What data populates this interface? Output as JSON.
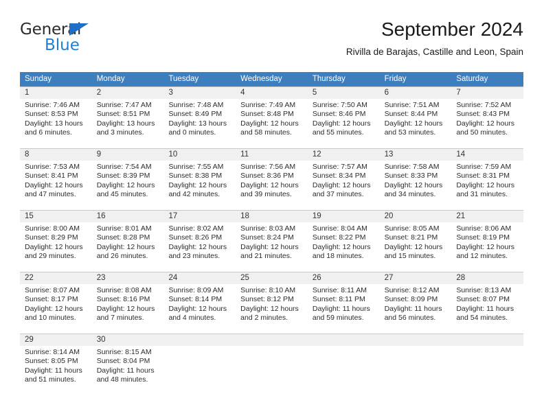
{
  "logo": {
    "word_top": "General",
    "word_bottom": "Blue",
    "triangle": "blue-triangle-icon",
    "color_dark": "#2b2b2b",
    "color_blue": "#1f7fd4"
  },
  "header": {
    "title": "September 2024",
    "subtitle": "Rivilla de Barajas, Castille and Leon, Spain"
  },
  "colors": {
    "header_blue": "#3d7ebe",
    "day_band_gray": "#f0f0f0",
    "grid_line": "#c8c8c8"
  },
  "weekdays": [
    "Sunday",
    "Monday",
    "Tuesday",
    "Wednesday",
    "Thursday",
    "Friday",
    "Saturday"
  ],
  "weeks": [
    {
      "numbers": [
        "1",
        "2",
        "3",
        "4",
        "5",
        "6",
        "7"
      ],
      "days": [
        {
          "sunrise": "Sunrise: 7:46 AM",
          "sunset": "Sunset: 8:53 PM",
          "daylight_1": "Daylight: 13 hours",
          "daylight_2": "and 6 minutes."
        },
        {
          "sunrise": "Sunrise: 7:47 AM",
          "sunset": "Sunset: 8:51 PM",
          "daylight_1": "Daylight: 13 hours",
          "daylight_2": "and 3 minutes."
        },
        {
          "sunrise": "Sunrise: 7:48 AM",
          "sunset": "Sunset: 8:49 PM",
          "daylight_1": "Daylight: 13 hours",
          "daylight_2": "and 0 minutes."
        },
        {
          "sunrise": "Sunrise: 7:49 AM",
          "sunset": "Sunset: 8:48 PM",
          "daylight_1": "Daylight: 12 hours",
          "daylight_2": "and 58 minutes."
        },
        {
          "sunrise": "Sunrise: 7:50 AM",
          "sunset": "Sunset: 8:46 PM",
          "daylight_1": "Daylight: 12 hours",
          "daylight_2": "and 55 minutes."
        },
        {
          "sunrise": "Sunrise: 7:51 AM",
          "sunset": "Sunset: 8:44 PM",
          "daylight_1": "Daylight: 12 hours",
          "daylight_2": "and 53 minutes."
        },
        {
          "sunrise": "Sunrise: 7:52 AM",
          "sunset": "Sunset: 8:43 PM",
          "daylight_1": "Daylight: 12 hours",
          "daylight_2": "and 50 minutes."
        }
      ]
    },
    {
      "numbers": [
        "8",
        "9",
        "10",
        "11",
        "12",
        "13",
        "14"
      ],
      "days": [
        {
          "sunrise": "Sunrise: 7:53 AM",
          "sunset": "Sunset: 8:41 PM",
          "daylight_1": "Daylight: 12 hours",
          "daylight_2": "and 47 minutes."
        },
        {
          "sunrise": "Sunrise: 7:54 AM",
          "sunset": "Sunset: 8:39 PM",
          "daylight_1": "Daylight: 12 hours",
          "daylight_2": "and 45 minutes."
        },
        {
          "sunrise": "Sunrise: 7:55 AM",
          "sunset": "Sunset: 8:38 PM",
          "daylight_1": "Daylight: 12 hours",
          "daylight_2": "and 42 minutes."
        },
        {
          "sunrise": "Sunrise: 7:56 AM",
          "sunset": "Sunset: 8:36 PM",
          "daylight_1": "Daylight: 12 hours",
          "daylight_2": "and 39 minutes."
        },
        {
          "sunrise": "Sunrise: 7:57 AM",
          "sunset": "Sunset: 8:34 PM",
          "daylight_1": "Daylight: 12 hours",
          "daylight_2": "and 37 minutes."
        },
        {
          "sunrise": "Sunrise: 7:58 AM",
          "sunset": "Sunset: 8:33 PM",
          "daylight_1": "Daylight: 12 hours",
          "daylight_2": "and 34 minutes."
        },
        {
          "sunrise": "Sunrise: 7:59 AM",
          "sunset": "Sunset: 8:31 PM",
          "daylight_1": "Daylight: 12 hours",
          "daylight_2": "and 31 minutes."
        }
      ]
    },
    {
      "numbers": [
        "15",
        "16",
        "17",
        "18",
        "19",
        "20",
        "21"
      ],
      "days": [
        {
          "sunrise": "Sunrise: 8:00 AM",
          "sunset": "Sunset: 8:29 PM",
          "daylight_1": "Daylight: 12 hours",
          "daylight_2": "and 29 minutes."
        },
        {
          "sunrise": "Sunrise: 8:01 AM",
          "sunset": "Sunset: 8:28 PM",
          "daylight_1": "Daylight: 12 hours",
          "daylight_2": "and 26 minutes."
        },
        {
          "sunrise": "Sunrise: 8:02 AM",
          "sunset": "Sunset: 8:26 PM",
          "daylight_1": "Daylight: 12 hours",
          "daylight_2": "and 23 minutes."
        },
        {
          "sunrise": "Sunrise: 8:03 AM",
          "sunset": "Sunset: 8:24 PM",
          "daylight_1": "Daylight: 12 hours",
          "daylight_2": "and 21 minutes."
        },
        {
          "sunrise": "Sunrise: 8:04 AM",
          "sunset": "Sunset: 8:22 PM",
          "daylight_1": "Daylight: 12 hours",
          "daylight_2": "and 18 minutes."
        },
        {
          "sunrise": "Sunrise: 8:05 AM",
          "sunset": "Sunset: 8:21 PM",
          "daylight_1": "Daylight: 12 hours",
          "daylight_2": "and 15 minutes."
        },
        {
          "sunrise": "Sunrise: 8:06 AM",
          "sunset": "Sunset: 8:19 PM",
          "daylight_1": "Daylight: 12 hours",
          "daylight_2": "and 12 minutes."
        }
      ]
    },
    {
      "numbers": [
        "22",
        "23",
        "24",
        "25",
        "26",
        "27",
        "28"
      ],
      "days": [
        {
          "sunrise": "Sunrise: 8:07 AM",
          "sunset": "Sunset: 8:17 PM",
          "daylight_1": "Daylight: 12 hours",
          "daylight_2": "and 10 minutes."
        },
        {
          "sunrise": "Sunrise: 8:08 AM",
          "sunset": "Sunset: 8:16 PM",
          "daylight_1": "Daylight: 12 hours",
          "daylight_2": "and 7 minutes."
        },
        {
          "sunrise": "Sunrise: 8:09 AM",
          "sunset": "Sunset: 8:14 PM",
          "daylight_1": "Daylight: 12 hours",
          "daylight_2": "and 4 minutes."
        },
        {
          "sunrise": "Sunrise: 8:10 AM",
          "sunset": "Sunset: 8:12 PM",
          "daylight_1": "Daylight: 12 hours",
          "daylight_2": "and 2 minutes."
        },
        {
          "sunrise": "Sunrise: 8:11 AM",
          "sunset": "Sunset: 8:11 PM",
          "daylight_1": "Daylight: 11 hours",
          "daylight_2": "and 59 minutes."
        },
        {
          "sunrise": "Sunrise: 8:12 AM",
          "sunset": "Sunset: 8:09 PM",
          "daylight_1": "Daylight: 11 hours",
          "daylight_2": "and 56 minutes."
        },
        {
          "sunrise": "Sunrise: 8:13 AM",
          "sunset": "Sunset: 8:07 PM",
          "daylight_1": "Daylight: 11 hours",
          "daylight_2": "and 54 minutes."
        }
      ]
    },
    {
      "numbers": [
        "29",
        "30",
        "",
        "",
        "",
        "",
        ""
      ],
      "days": [
        {
          "sunrise": "Sunrise: 8:14 AM",
          "sunset": "Sunset: 8:05 PM",
          "daylight_1": "Daylight: 11 hours",
          "daylight_2": "and 51 minutes."
        },
        {
          "sunrise": "Sunrise: 8:15 AM",
          "sunset": "Sunset: 8:04 PM",
          "daylight_1": "Daylight: 11 hours",
          "daylight_2": "and 48 minutes."
        },
        {
          "sunrise": "",
          "sunset": "",
          "daylight_1": "",
          "daylight_2": ""
        },
        {
          "sunrise": "",
          "sunset": "",
          "daylight_1": "",
          "daylight_2": ""
        },
        {
          "sunrise": "",
          "sunset": "",
          "daylight_1": "",
          "daylight_2": ""
        },
        {
          "sunrise": "",
          "sunset": "",
          "daylight_1": "",
          "daylight_2": ""
        },
        {
          "sunrise": "",
          "sunset": "",
          "daylight_1": "",
          "daylight_2": ""
        }
      ]
    }
  ]
}
